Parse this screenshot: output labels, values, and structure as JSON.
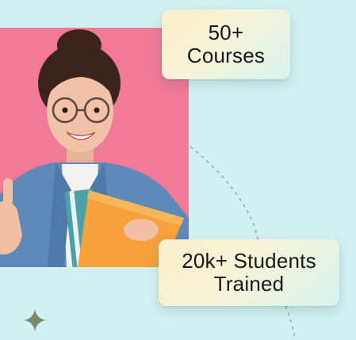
{
  "hero": {
    "photo": {
      "description_icon": "student-with-books-photo",
      "background_color": "#f07a97"
    },
    "stats": [
      {
        "value": "50+",
        "label": "Courses"
      },
      {
        "value": "20k+ Students",
        "label": "Trained"
      }
    ],
    "decorations": {
      "sparkle_icon": "sparkle-icon",
      "sparkle_color": "#7b8a6a",
      "connector_color": "#8a9aa2"
    },
    "colors": {
      "background": "#d2f0f1",
      "card_gradient_start": "#fbeec9",
      "card_gradient_end": "#d8f3ee",
      "text": "#16171a"
    }
  }
}
